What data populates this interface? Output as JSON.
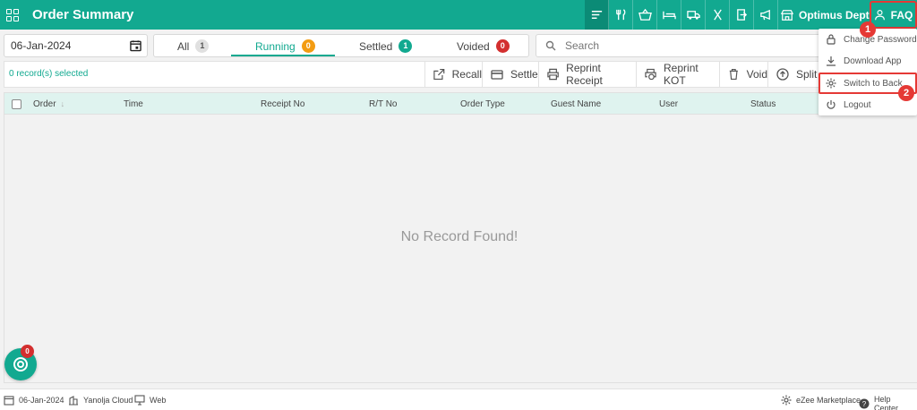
{
  "header": {
    "title": "Order Summary",
    "toolbar_icons": [
      "sort-lines-icon",
      "restaurant-icon",
      "basket-icon",
      "bed-icon",
      "truck-icon",
      "cutlery-icon",
      "exit-door-icon",
      "megaphone-icon"
    ],
    "outlet_name": "Optimus Dept",
    "faq_label": "FAQ"
  },
  "filters": {
    "date": "06-Jan-2024",
    "tabs": [
      {
        "label": "All",
        "count": "1",
        "badge_color": "#e0e0e0",
        "badge_text_color": "#555"
      },
      {
        "label": "Running",
        "count": "0",
        "badge_color": "#f39c12",
        "badge_text_color": "#ffffff"
      },
      {
        "label": "Settled",
        "count": "1",
        "badge_color": "#12a990",
        "badge_text_color": "#ffffff"
      },
      {
        "label": "Voided",
        "count": "0",
        "badge_color": "#d32f2f",
        "badge_text_color": "#ffffff"
      }
    ],
    "active_tab": "Running",
    "search_placeholder": "Search"
  },
  "actions": {
    "selected_text": "0 record(s) selected",
    "buttons": [
      "Recall",
      "Settle",
      "Reprint Receipt",
      "Reprint KOT",
      "Void",
      "Split"
    ]
  },
  "table": {
    "columns": [
      "Order",
      "Time",
      "Receipt No",
      "R/T No",
      "Order Type",
      "Guest Name",
      "User",
      "Status"
    ],
    "empty_message": "No Record Found!"
  },
  "user_menu": {
    "items": [
      "Change Password",
      "Download App",
      "Switch to Back",
      "Logout"
    ],
    "markers": [
      "1",
      "2"
    ]
  },
  "chat": {
    "badge": "0"
  },
  "footer": {
    "date": "06-Jan-2024",
    "cloud": "Yanolja Cloud",
    "platform": "Web",
    "marketplace": "eZee Marketplace",
    "help": "Help Center"
  },
  "colors": {
    "brand": "#12a990",
    "highlight": "#e53935"
  }
}
